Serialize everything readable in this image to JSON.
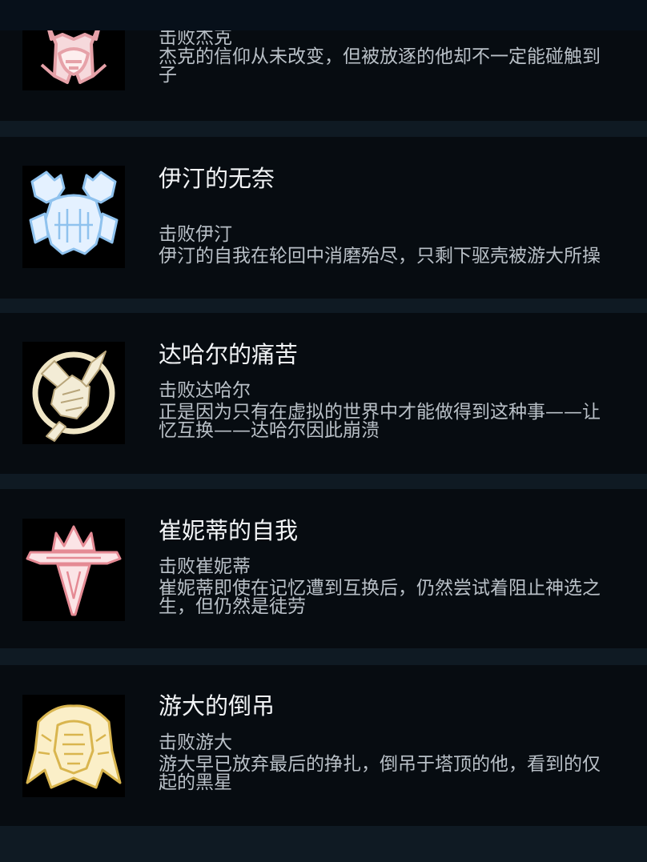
{
  "achievements": [
    {
      "icon": "jack-crest-icon",
      "icon_color": "#e6a1a8",
      "title": "",
      "subtitle": "击败杰克",
      "desc_line1": "杰克的信仰从未改变，但被放逐的他却不一定能碰触到",
      "desc_line2": "子"
    },
    {
      "icon": "yiting-crest-icon",
      "icon_color": "#bfe0ff",
      "title": "伊汀的无奈",
      "subtitle": "击败伊汀",
      "desc_line1": "伊汀的自我在轮回中消磨殆尽，只剩下驱壳被游大所操",
      "desc_line2": ""
    },
    {
      "icon": "daharr-crest-icon",
      "icon_color": "#f0e6c6",
      "title": "达哈尔的痛苦",
      "subtitle": "击败达哈尔",
      "desc_line1": "正是因为只有在虚拟的世界中才能做得到这种事——让",
      "desc_line2": "忆互换——达哈尔因此崩溃"
    },
    {
      "icon": "cuinidi-crest-icon",
      "icon_color": "#f3c4c9",
      "title": "崔妮蒂的自我",
      "subtitle": "击败崔妮蒂",
      "desc_line1": "崔妮蒂即使在记忆遭到互换后，仍然尝试着阻止神选之",
      "desc_line2": "生，但仍然是徒劳"
    },
    {
      "icon": "youda-crest-icon",
      "icon_color": "#f3dc8f",
      "title": "游大的倒吊",
      "subtitle": "击败游大",
      "desc_line1": "游大早已放弃最后的挣扎，倒吊于塔顶的他，看到的仅",
      "desc_line2": "起的黑星"
    }
  ]
}
